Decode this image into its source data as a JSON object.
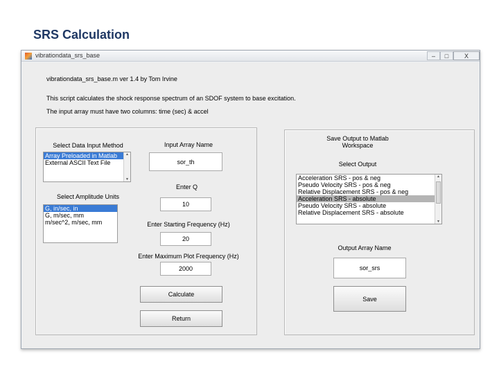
{
  "slide": {
    "title": "SRS Calculation"
  },
  "window": {
    "title": "vibrationdata_srs_base",
    "controls": {
      "minimize": "–",
      "maximize": "□",
      "close": "X"
    }
  },
  "info": {
    "line1": "vibrationdata_srs_base.m ver 1.4 by Tom Irvine",
    "line2": "This script calculates the shock response spectrum of an SDOF system to base excitation.",
    "line3": "The input array must have two columns: time (sec) & accel"
  },
  "left_panel": {
    "input_method": {
      "label": "Select Data Input Method",
      "items": [
        "Array Preloaded in Matlab",
        "External ASCII Text File"
      ]
    },
    "amplitude_units": {
      "label": "Select Amplitude Units",
      "items": [
        "G, in/sec, in",
        "G, m/sec, mm",
        "m/sec^2, m/sec, mm"
      ]
    },
    "input_array": {
      "label": "Input Array Name",
      "value": "sor_th"
    },
    "q": {
      "label": "Enter Q",
      "value": "10"
    },
    "start_freq": {
      "label": "Enter Starting Frequency (Hz)",
      "value": "20"
    },
    "max_freq": {
      "label": "Enter Maximum Plot Frequency (Hz)",
      "value": "2000"
    },
    "calculate_label": "Calculate",
    "return_label": "Return"
  },
  "right_panel": {
    "title_line1": "Save Output to Matlab",
    "title_line2": "Workspace",
    "select_output_label": "Select Output",
    "outputs": [
      "Acceleration SRS - pos & neg",
      "Pseudo Velocity SRS - pos & neg",
      "Relative Displacement SRS - pos & neg",
      "Acceleration SRS - absolute",
      "Pseudo Velocity SRS - absolute",
      "Relative Displacement SRS - absolute"
    ],
    "output_array_label": "Output Array Name",
    "output_array_value": "sor_srs",
    "save_label": "Save"
  }
}
